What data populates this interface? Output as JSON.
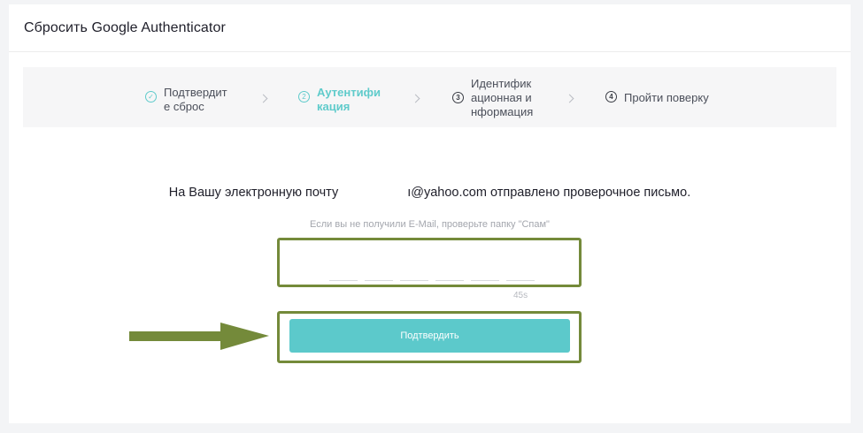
{
  "header": {
    "title": "Сбросить Google Authenticator"
  },
  "stepper": {
    "steps": [
      {
        "icon": "check-circle",
        "line1": "Подтвердит",
        "line2": "е сброс",
        "line3": "",
        "state": "done"
      },
      {
        "icon": "2",
        "line1": "Аутентифи",
        "line2": "кация",
        "line3": "",
        "state": "active"
      },
      {
        "icon": "3",
        "line1": "Идентифик",
        "line2": "ационная и",
        "line3": "нформация",
        "state": "todo"
      },
      {
        "icon": "4",
        "line1": "Пройти поверку",
        "line2": "",
        "line3": "",
        "state": "todo"
      }
    ]
  },
  "verification": {
    "message_before": "На Вашу электронную почту",
    "email_visible": "ı@yahoo.com",
    "message_after": "отправлено проверочное письмо.",
    "hint": "Если вы не получили E-Mail, проверьте папку \"Спам\"",
    "code_digits": [
      "",
      "",
      "",
      "",
      "",
      ""
    ],
    "timer": "45s",
    "confirm_label": "Подтвердить"
  },
  "colors": {
    "accent": "#5cc9cb",
    "highlight_frame": "#748a3a",
    "arrow": "#748a3a"
  }
}
